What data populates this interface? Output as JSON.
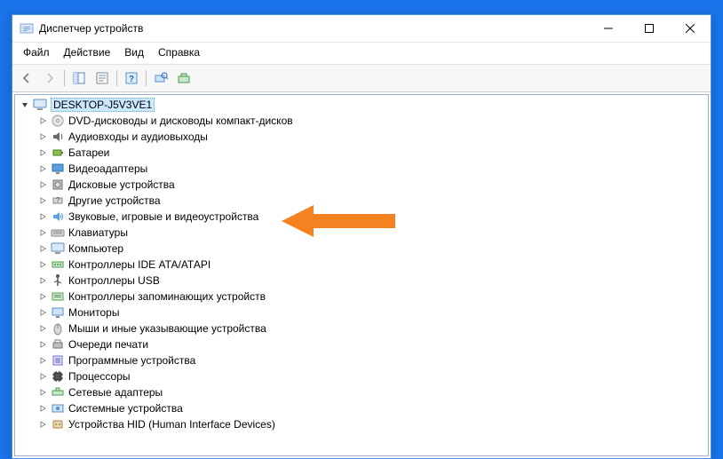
{
  "window": {
    "title": "Диспетчер устройств"
  },
  "menu": {
    "file": "Файл",
    "action": "Действие",
    "view": "Вид",
    "help": "Справка"
  },
  "root": {
    "name": "DESKTOP-J5V3VE1"
  },
  "nodes": [
    {
      "icon": "dvd",
      "label": "DVD-дисководы и дисководы компакт-дисков"
    },
    {
      "icon": "audio",
      "label": "Аудиовходы и аудиовыходы"
    },
    {
      "icon": "battery",
      "label": "Батареи"
    },
    {
      "icon": "display",
      "label": "Видеоадаптеры"
    },
    {
      "icon": "disk",
      "label": "Дисковые устройства"
    },
    {
      "icon": "other",
      "label": "Другие устройства"
    },
    {
      "icon": "sound",
      "label": "Звуковые, игровые и видеоустройства"
    },
    {
      "icon": "keyboard",
      "label": "Клавиатуры"
    },
    {
      "icon": "computer",
      "label": "Компьютер"
    },
    {
      "icon": "ide",
      "label": "Контроллеры IDE АТА/АТАРI"
    },
    {
      "icon": "usb",
      "label": "Контроллеры USB"
    },
    {
      "icon": "storage",
      "label": "Контроллеры запоминающих устройств"
    },
    {
      "icon": "monitor",
      "label": "Мониторы"
    },
    {
      "icon": "mouse",
      "label": "Мыши и иные указывающие устройства"
    },
    {
      "icon": "printq",
      "label": "Очереди печати"
    },
    {
      "icon": "software",
      "label": "Программные устройства"
    },
    {
      "icon": "cpu",
      "label": "Процессоры"
    },
    {
      "icon": "network",
      "label": "Сетевые адаптеры"
    },
    {
      "icon": "system",
      "label": "Системные устройства"
    },
    {
      "icon": "hid",
      "label": "Устройства HID (Human Interface Devices)"
    }
  ]
}
